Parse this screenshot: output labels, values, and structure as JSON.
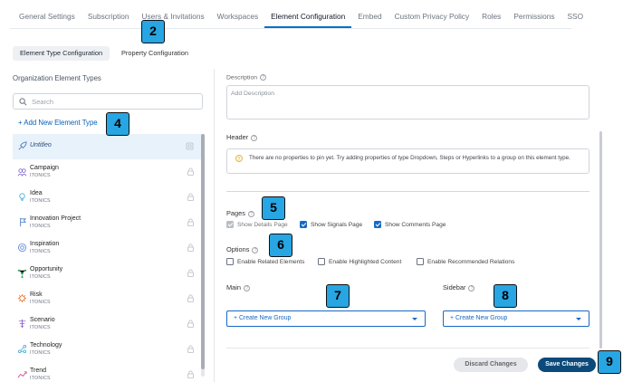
{
  "top_tabs": [
    {
      "label": "General Settings"
    },
    {
      "label": "Subscription"
    },
    {
      "label": "Users & Invitations"
    },
    {
      "label": "Workspaces"
    },
    {
      "label": "Element Configuration",
      "active": true
    },
    {
      "label": "Embed"
    },
    {
      "label": "Custom Privacy Policy"
    },
    {
      "label": "Roles"
    },
    {
      "label": "Permissions"
    },
    {
      "label": "SSO"
    }
  ],
  "sub_tabs": [
    {
      "label": "Element Type Configuration",
      "active": true
    },
    {
      "label": "Property Configuration"
    }
  ],
  "left": {
    "title": "Organization Element Types",
    "search_placeholder": "Search",
    "add_label": "+ Add New Element Type",
    "items": [
      {
        "name": "Untitleo",
        "sub": "",
        "icon": "rocket-icon",
        "color": "#4a7fc1"
      },
      {
        "name": "Campaign",
        "sub": "ITONICS",
        "icon": "people-icon",
        "color": "#7b5fc9"
      },
      {
        "name": "Idea",
        "sub": "ITONICS",
        "icon": "lightbulb-icon",
        "color": "#3fa9d9"
      },
      {
        "name": "Innovation Project",
        "sub": "ITONICS",
        "icon": "flag-icon",
        "color": "#4a7fc1"
      },
      {
        "name": "Inspiration",
        "sub": "ITONICS",
        "icon": "target-icon",
        "color": "#5b7ed6"
      },
      {
        "name": "Opportunity",
        "sub": "ITONICS",
        "icon": "network-icon",
        "color": "#2e9e5a"
      },
      {
        "name": "Risk",
        "sub": "ITONICS",
        "icon": "hazard-icon",
        "color": "#e06b2b"
      },
      {
        "name": "Scenario",
        "sub": "ITONICS",
        "icon": "scenario-icon",
        "color": "#8e5fc9"
      },
      {
        "name": "Technology",
        "sub": "ITONICS",
        "icon": "tech-icon",
        "color": "#3fa9d9"
      },
      {
        "name": "Trend",
        "sub": "ITONICS",
        "icon": "trend-icon",
        "color": "#d94f8a"
      }
    ]
  },
  "right": {
    "description_label": "Description",
    "description_placeholder": "Add Description",
    "header_label": "Header",
    "header_message": "There are no properties to pin yet. Try adding properties of type Dropdown, Steps or Hyperlinks to a group on this element type.",
    "pages_label": "Pages",
    "pages": [
      {
        "label": "Show Details Page",
        "checked": true,
        "disabled": true
      },
      {
        "label": "Show Signals Page",
        "checked": true,
        "disabled": false
      },
      {
        "label": "Show Comments Page",
        "checked": true,
        "disabled": false
      }
    ],
    "options_label": "Options",
    "options": [
      {
        "label": "Enable Related Elements",
        "checked": false
      },
      {
        "label": "Enable Highlighted Content",
        "checked": false
      },
      {
        "label": "Enable Recommended Relations",
        "checked": false
      }
    ],
    "main_label": "Main",
    "sidebar_label": "Sidebar",
    "main_dropdown": "+ Create New Group",
    "sidebar_dropdown": "+ Create New Group",
    "discard_label": "Discard Changes",
    "save_label": "Save Changes"
  },
  "badges": [
    "2",
    "4",
    "5",
    "6",
    "7",
    "8",
    "9"
  ],
  "colors": {
    "accent": "#0a71c2",
    "primary_button": "#0b4a7a",
    "badge": "#27a6e3"
  }
}
